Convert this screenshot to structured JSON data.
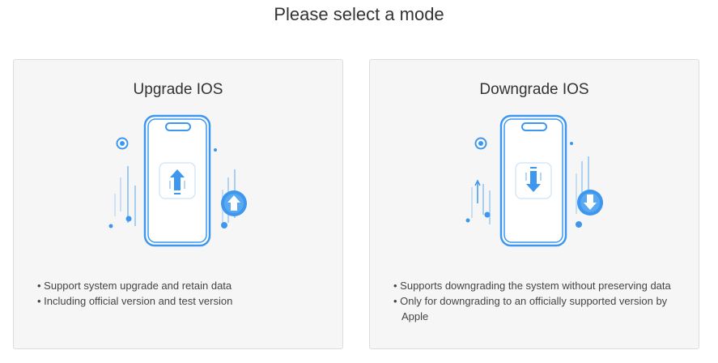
{
  "header": {
    "title": "Please select a mode"
  },
  "modes": [
    {
      "title": "Upgrade IOS",
      "icon": "phone-upgrade-arrow-icon",
      "bullets": [
        "Support system upgrade and retain data",
        "Including official version and test version"
      ]
    },
    {
      "title": "Downgrade IOS",
      "icon": "phone-downgrade-arrow-icon",
      "bullets": [
        "Supports downgrading the system without preserving data",
        "Only for downgrading to an officially supported version by Apple"
      ]
    }
  ],
  "colors": {
    "accent": "#3d97ee",
    "card_background": "#f6f6f6",
    "card_border": "#dcdcdc",
    "text": "#333333"
  }
}
